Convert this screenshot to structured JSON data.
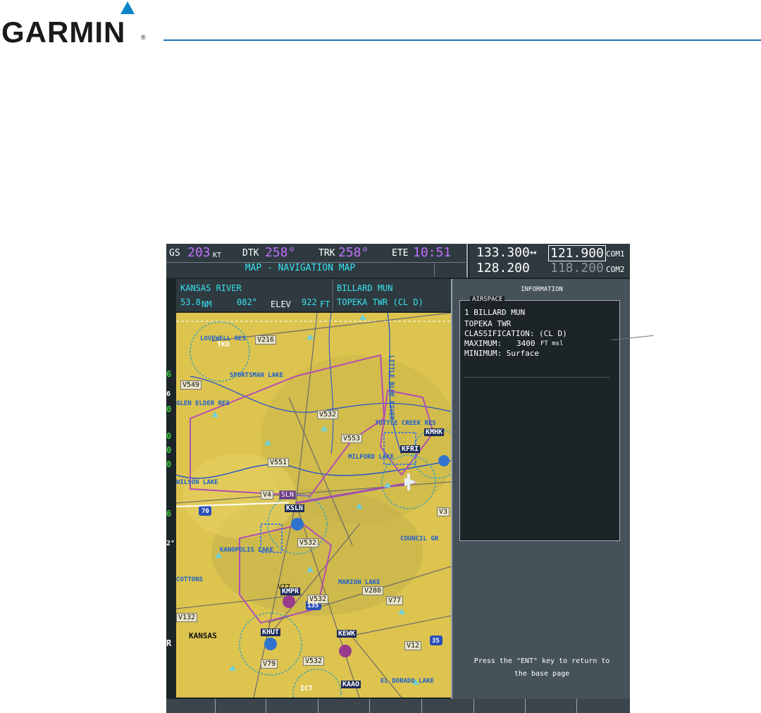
{
  "brand": {
    "name": "GARMIN",
    "reg": "®"
  },
  "statusbar": {
    "gs_label": "GS",
    "gs_value": "203",
    "gs_unit": "KT",
    "dtk_label": "DTK",
    "dtk_value": "258°",
    "trk_label": "TRK",
    "trk_value": "258°",
    "ete_label": "ETE",
    "ete_value": "10:51"
  },
  "page_title": "MAP - NAVIGATION MAP",
  "com": {
    "com1_active": "133.300",
    "com1_standby": "121.900",
    "com1_label": "COM1",
    "swap_icon": "↔",
    "com2_active": "128.200",
    "com2_standby": "118.200",
    "com2_label": "COM2"
  },
  "waypoint_left": {
    "name": "KANSAS RIVER",
    "dist": "53.8",
    "dist_unit": "NM",
    "bearing": "082°",
    "elev_label": "ELEV",
    "elev_value": "922",
    "elev_unit": "FT"
  },
  "waypoint_right": {
    "name": "BILLARD MUN",
    "facility": "TOPEKA TWR (CL D)"
  },
  "left_strip": [
    "6",
    "6",
    "0",
    "0",
    "0",
    "0",
    "6",
    "2°",
    "R"
  ],
  "map_labels": {
    "v216": "V216",
    "tko": "TKO",
    "v549": "V549",
    "v532a": "V532",
    "v553": "V553",
    "v551": "V551",
    "v4": "V4",
    "sln": "SLN",
    "ksln": "KSLN",
    "v532b": "V532",
    "kmhk": "KMHK",
    "kfri": "KFRI",
    "v3": "V3",
    "kmpr": "KMPR",
    "v77a": "V77",
    "v532c": "V532",
    "v280": "V280",
    "v77b": "V77",
    "v132": "V132",
    "khut": "KHUT",
    "kewk": "KEWK",
    "v12": "V12",
    "v79": "V79",
    "v532d": "V532",
    "ict": "ICT",
    "kaao": "KAAO",
    "i70": "70",
    "i135": "135",
    "i35": "35",
    "lovewell": "LOVEWELL RES",
    "sportsman": "SPORTSMAN LAKE",
    "glen_elder": "GLEN ELDER RES",
    "tuttle": "TUTTLE CREEK RES",
    "milford": "MILFORD LAKE",
    "council": "COUNCIL GR",
    "kanopolis": "KANOPOLIS LAKE",
    "marion": "MARION LAKE",
    "el_dorado": "EL DORADO LAKE",
    "kansas": "KANSAS",
    "wilson": "WILSON LAKE",
    "cottons": "COTTONS",
    "little_blue": "LITTLE BLUE RIVER"
  },
  "info_panel": {
    "title": "INFORMATION",
    "tag": "AIRSPACE",
    "line1": "1 BILLARD MUN",
    "line2": "TOPEKA TWR",
    "line3": "CLASSIFICATION: (CL D)",
    "line4_label": "MAXIMUM:",
    "line4_value": "3400",
    "line4_unit": "FT msl",
    "line5": "MINIMUM: Surface",
    "footer1": "Press the \"ENT\" key to return to",
    "footer2": "the base page"
  }
}
